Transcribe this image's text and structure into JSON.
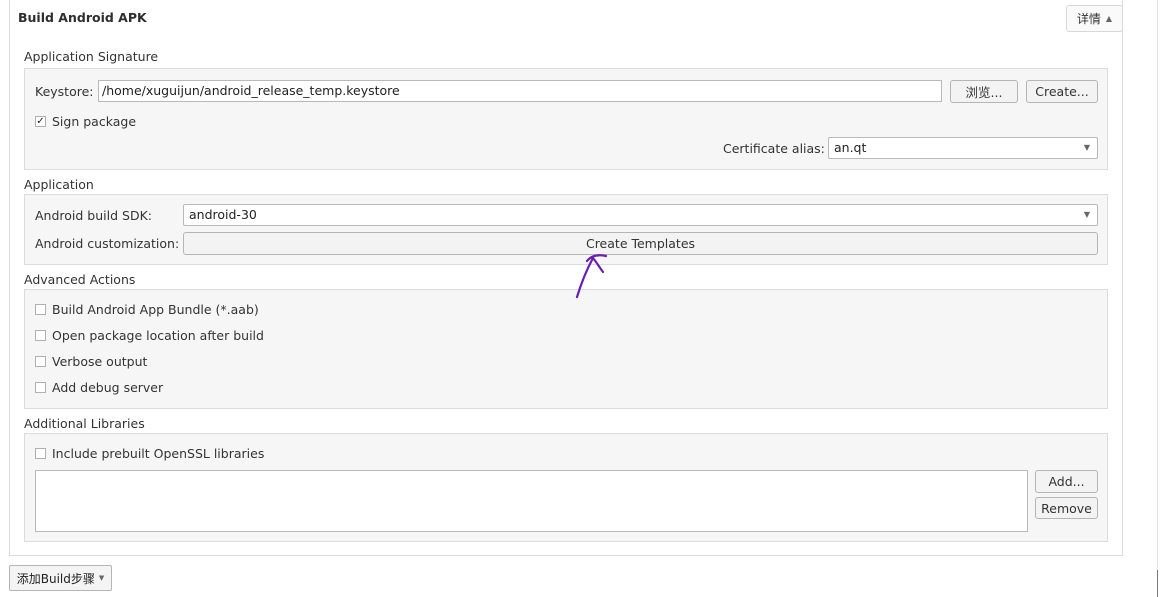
{
  "header": {
    "title": "Build Android APK",
    "details_label": "详情"
  },
  "signature": {
    "section_label": "Application Signature",
    "keystore_label": "Keystore:",
    "keystore_value": "/home/xuguijun/android_release_temp.keystore",
    "browse_label": "浏览...",
    "create_label": "Create...",
    "sign_package_label": "Sign package",
    "sign_package_checked": true,
    "cert_alias_label": "Certificate alias:",
    "cert_alias_value": "an.qt"
  },
  "application": {
    "section_label": "Application",
    "sdk_label": "Android build SDK:",
    "sdk_value": "android-30",
    "customization_label": "Android customization:",
    "create_templates_label": "Create Templates"
  },
  "advanced": {
    "section_label": "Advanced Actions",
    "options": [
      {
        "label": "Build Android App Bundle (*.aab)",
        "checked": false
      },
      {
        "label": "Open package location after build",
        "checked": false
      },
      {
        "label": "Verbose output",
        "checked": false
      },
      {
        "label": "Add debug server",
        "checked": false
      }
    ]
  },
  "libraries": {
    "section_label": "Additional Libraries",
    "openssl_label": "Include prebuilt OpenSSL libraries",
    "openssl_checked": false,
    "add_label": "Add...",
    "remove_label": "Remove"
  },
  "footer": {
    "add_build_step_label": "添加Build步骤"
  },
  "colors": {
    "annotation": "#6a1fb0"
  }
}
